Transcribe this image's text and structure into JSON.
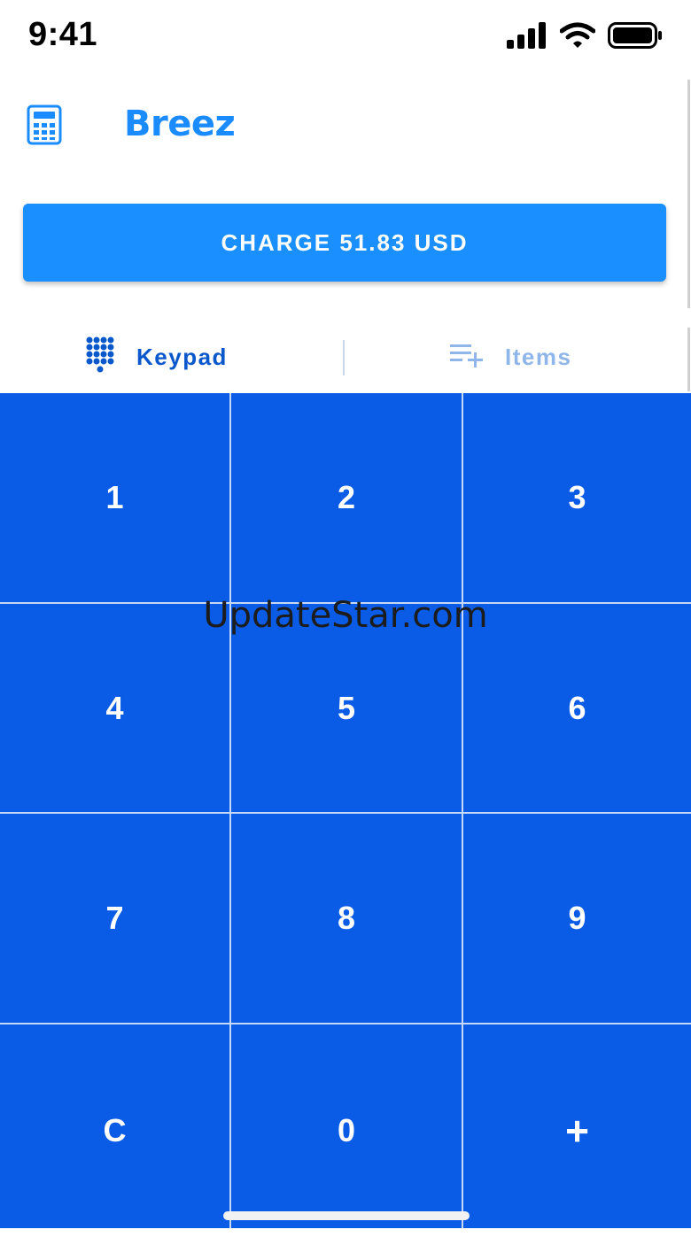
{
  "status_bar": {
    "time": "9:41",
    "icons": [
      "cellular-signal-icon",
      "wifi-icon",
      "battery-icon"
    ]
  },
  "header": {
    "brand": "Breez",
    "calculator_icon": "calculator-icon"
  },
  "charge_button": {
    "label": "CHARGE 51.83 USD"
  },
  "tabs": {
    "keypad": {
      "label": "Keypad",
      "icon": "keypad-dots-icon",
      "active": true
    },
    "items": {
      "label": "Items",
      "icon": "list-add-icon",
      "active": false
    }
  },
  "keypad": {
    "keys": [
      "1",
      "2",
      "3",
      "4",
      "5",
      "6",
      "7",
      "8",
      "9",
      "C",
      "0",
      "+"
    ]
  },
  "watermark": {
    "text": "UpdateStar.com"
  },
  "colors": {
    "accent": "#1a8fff",
    "keypad_bg": "#0a5ce6",
    "tab_active": "#0a58cc",
    "tab_inactive": "#8fb6ea"
  }
}
